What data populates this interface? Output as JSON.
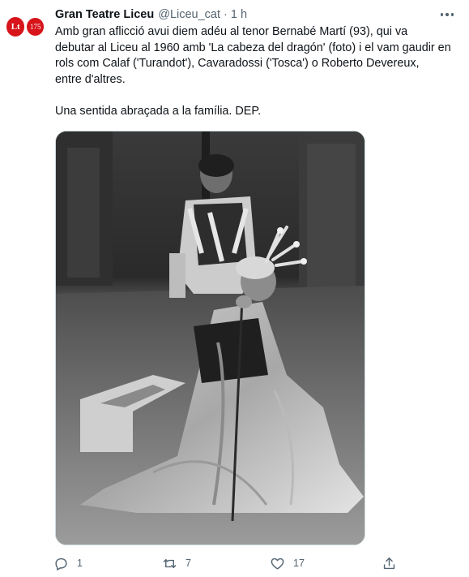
{
  "account": {
    "avatar_mark": "Lt",
    "avatar_badge": "175",
    "display_name": "Gran Teatre Liceu",
    "handle": "@Liceu_cat",
    "separator": "·",
    "time": "1 h",
    "brand_color": "#d7141a"
  },
  "tweet": {
    "text": "Amb gran aflicció avui diem adéu al tenor Bernabé Martí (93), qui va\ndebutar al Liceu al 1960 amb 'La cabeza del dragón' (foto) i el vam gaudir en\nrols com Calaf ('Turandot'), Cavaradossi ('Tosca') o Roberto Devereux,\nentre d'altres.\n\nUna sentida abraçada a la família. DEP."
  },
  "actions": {
    "reply": {
      "icon": "reply-icon",
      "count": "1"
    },
    "retweet": {
      "icon": "retweet-icon",
      "count": "7"
    },
    "like": {
      "icon": "heart-icon",
      "count": "17"
    },
    "share": {
      "icon": "share-icon"
    }
  },
  "colors": {
    "text_primary": "#0f1419",
    "text_secondary": "#536471",
    "border": "#cfd9de"
  }
}
